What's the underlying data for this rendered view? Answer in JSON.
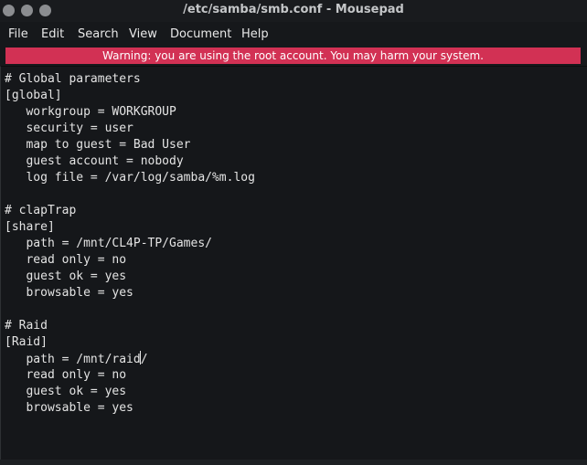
{
  "window": {
    "title": "/etc/samba/smb.conf - Mousepad"
  },
  "menu": [
    {
      "label": "File"
    },
    {
      "label": "Edit"
    },
    {
      "label": "Search"
    },
    {
      "label": "View"
    },
    {
      "label": "Document"
    },
    {
      "label": "Help"
    }
  ],
  "warning": "Warning: you are using the root account. You may harm your system.",
  "editor": {
    "lines": [
      "# Global parameters",
      "[global]",
      "   workgroup = WORKGROUP",
      "   security = user",
      "   map to guest = Bad User",
      "   guest account = nobody",
      "   log file = /var/log/samba/%m.log",
      "",
      "# clapTrap",
      "[share]",
      "   path = /mnt/CL4P-TP/Games/",
      "   read only = no",
      "   guest ok = yes",
      "   browsable = yes",
      "",
      "# Raid",
      "[Raid]",
      "   path = /mnt/raid/",
      "   read only = no",
      "   guest ok = yes",
      "   browsable = yes"
    ]
  },
  "colors": {
    "warning_bg": "#d23154",
    "background": "#16181b",
    "text": "#e4e4e4"
  }
}
